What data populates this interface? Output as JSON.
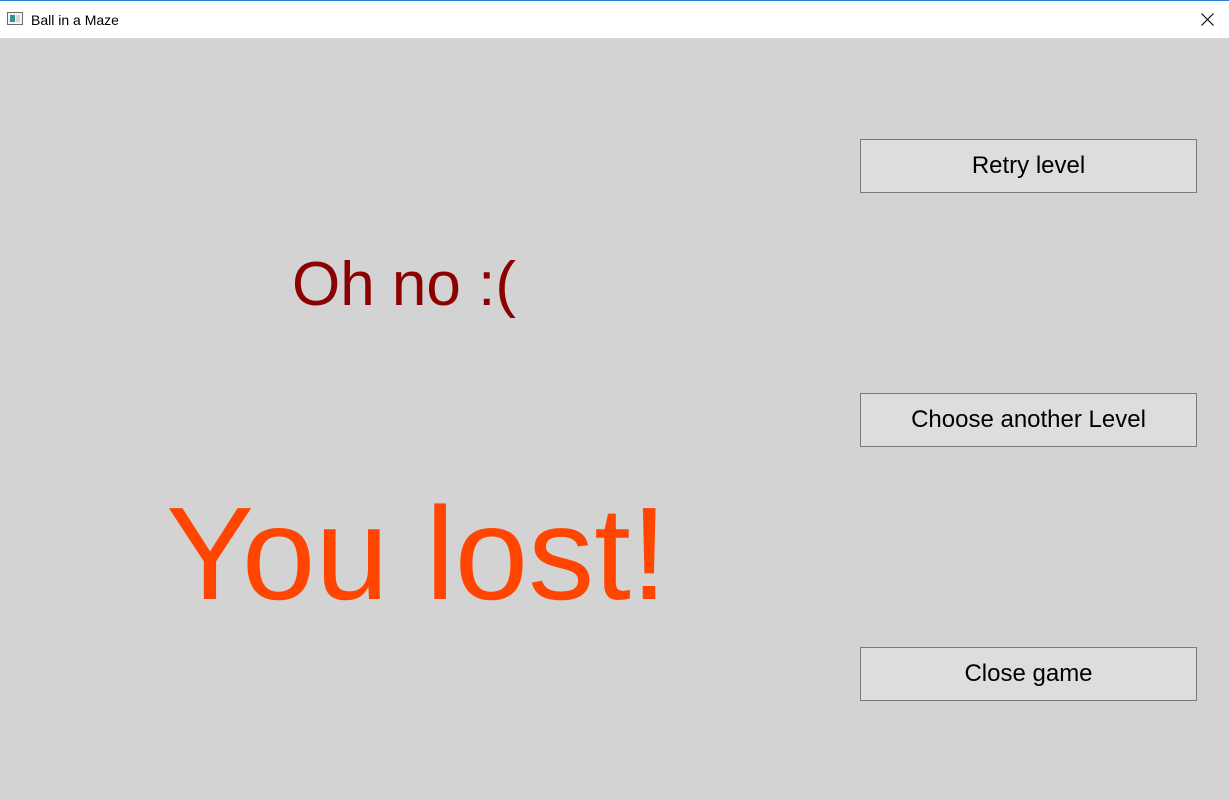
{
  "window": {
    "title": "Ball in a Maze",
    "icon": "app-window-icon",
    "close_icon": "close-icon"
  },
  "messages": {
    "headline": "Oh no :(",
    "result": "You lost!"
  },
  "buttons": {
    "retry": "Retry level",
    "choose_level": "Choose another Level",
    "close_game": "Close game"
  },
  "colors": {
    "background": "#d3d3d3",
    "headline": "#8b0000",
    "result": "#ff4500",
    "button_bg": "#dddddd",
    "button_border": "#7a7a7a"
  }
}
